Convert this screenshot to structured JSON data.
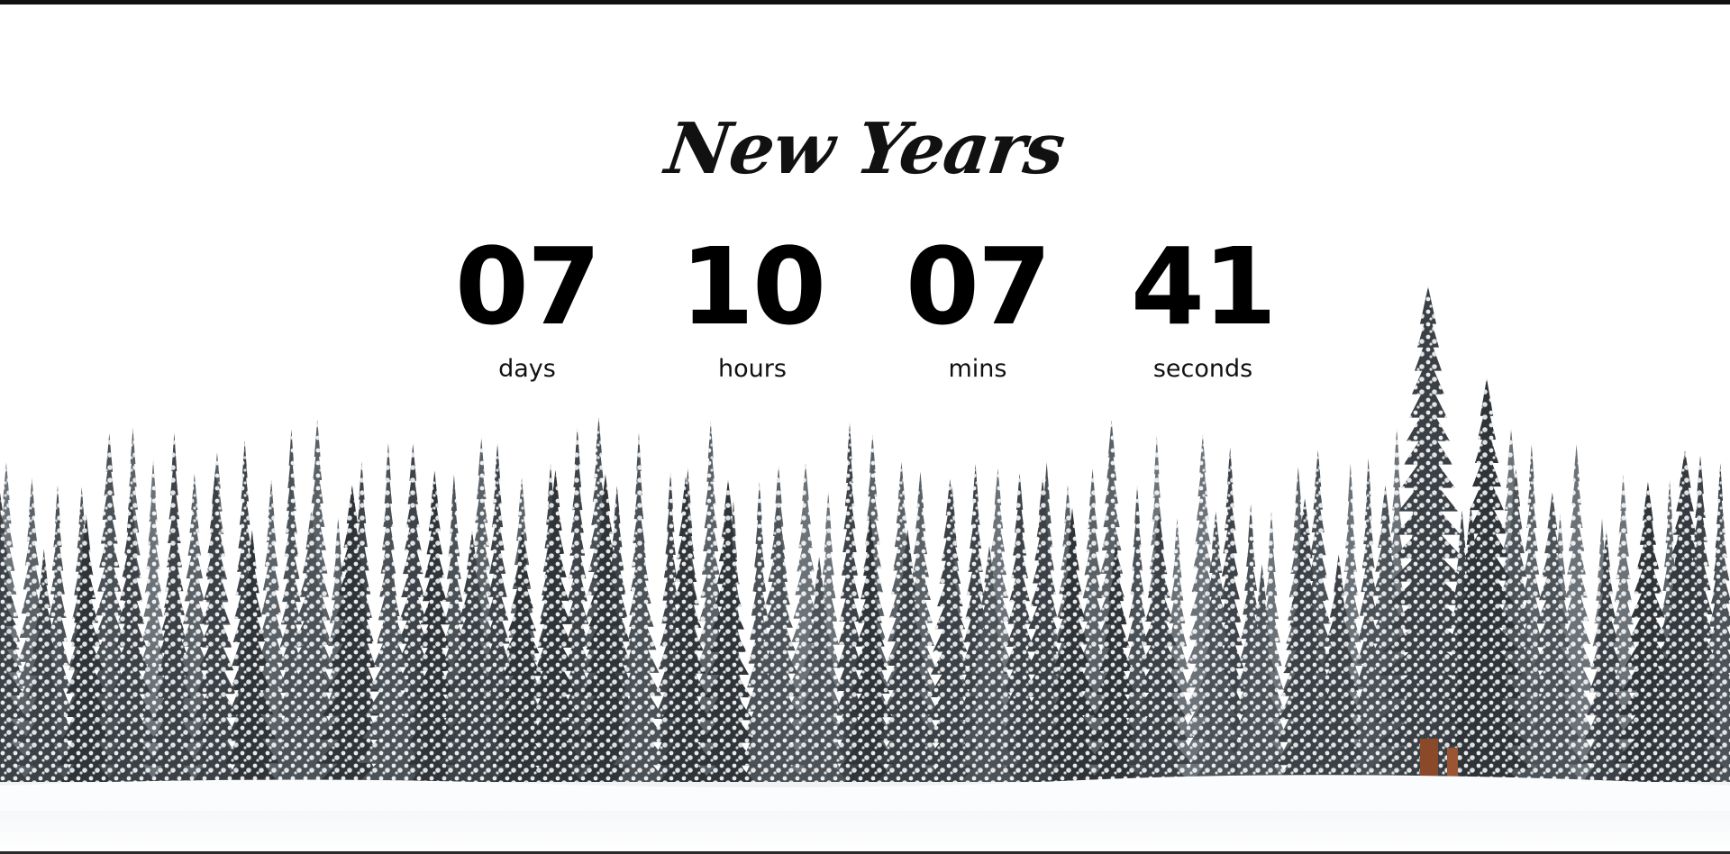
{
  "title": "New Years",
  "countdown": {
    "days": {
      "value": "07",
      "label": "days"
    },
    "hours": {
      "value": "10",
      "label": "hours"
    },
    "mins": {
      "value": "07",
      "label": "mins"
    },
    "seconds": {
      "value": "41",
      "label": "seconds"
    }
  },
  "colors": {
    "background": "#ffffff",
    "text": "#111111",
    "snow": "#f4f6f8",
    "tree_dark": "#2f3438",
    "trunk": "#8a4a2a"
  },
  "scene": {
    "icon": "snowy-pine-forest-image"
  }
}
